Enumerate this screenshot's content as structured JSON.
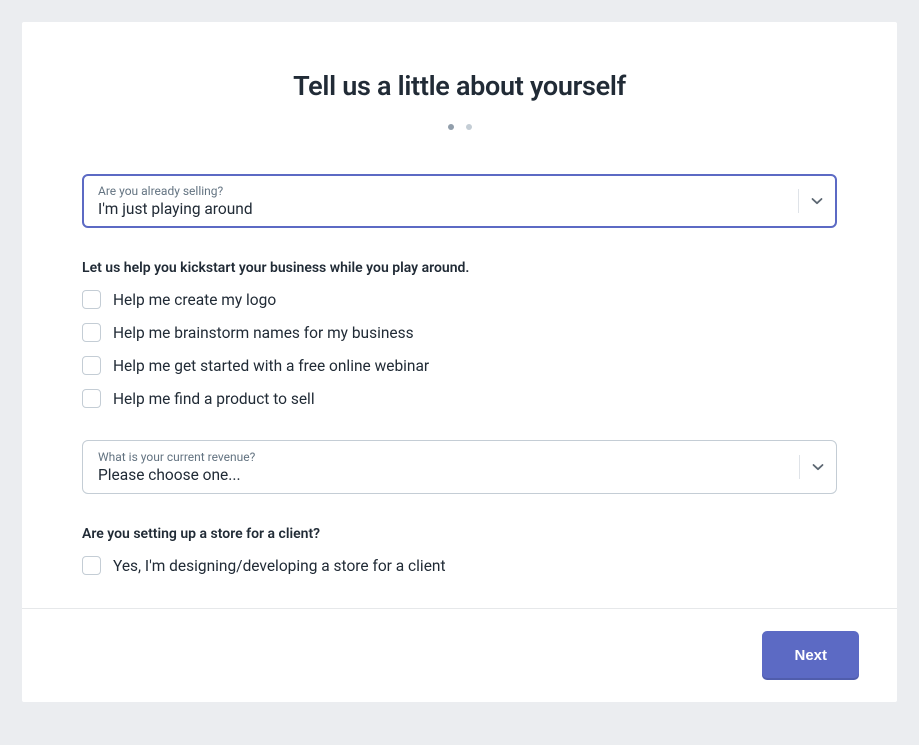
{
  "title": "Tell us a little about yourself",
  "pagination": {
    "current": 1,
    "total": 2
  },
  "selling": {
    "label": "Are you already selling?",
    "value": "I'm just playing around"
  },
  "kickstart": {
    "heading": "Let us help you kickstart your business while you play around.",
    "options": [
      "Help me create my logo",
      "Help me brainstorm names for my business",
      "Help me get started with a free online webinar",
      "Help me find a product to sell"
    ]
  },
  "revenue": {
    "label": "What is your current revenue?",
    "value": "Please choose one..."
  },
  "client": {
    "heading": "Are you setting up a store for a client?",
    "option": "Yes, I'm designing/developing a store for a client"
  },
  "buttons": {
    "next": "Next"
  }
}
